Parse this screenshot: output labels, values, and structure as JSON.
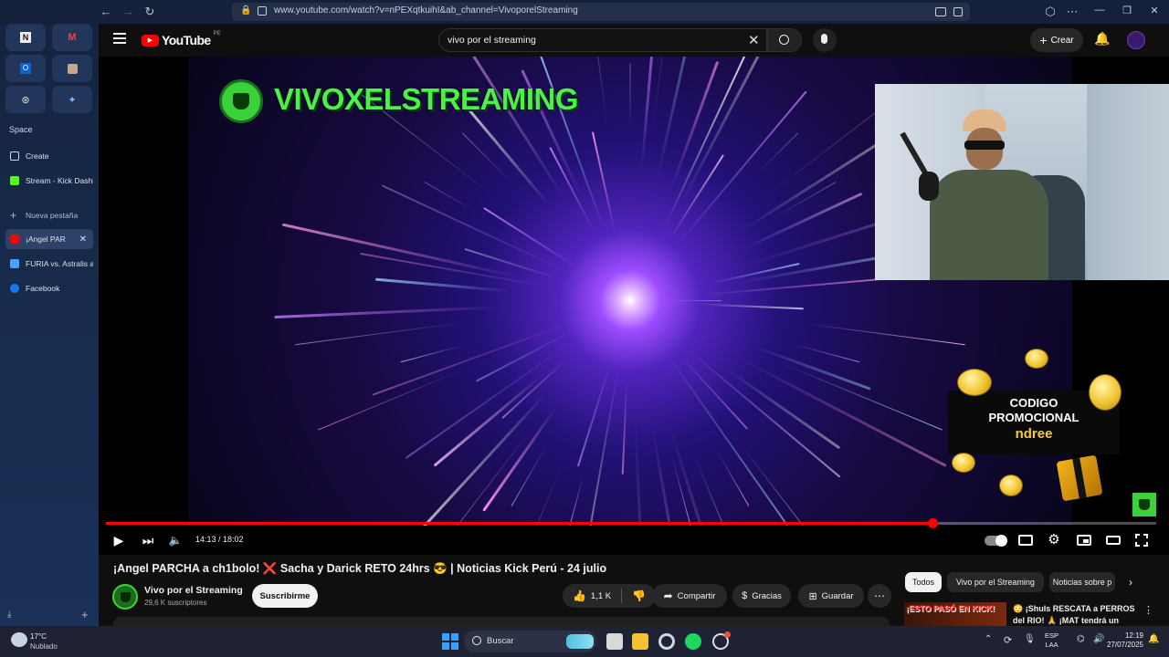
{
  "browser": {
    "url": "www.youtube.com/watch?v=nPEXqtkuihI&ab_channel=VivoporelStreaming"
  },
  "sidebar": {
    "section_label": "Space",
    "items": [
      {
        "label": "Create",
        "color": "#cfd6e4"
      },
      {
        "label": "Stream - Kick Dashb",
        "color": "#53fc18"
      },
      {
        "label": "Nueva pestaña",
        "color": "#cfd6e4"
      },
      {
        "label": "¡Angel PAR",
        "color": "#ff0000"
      },
      {
        "label": "FURIA vs. Astralis at",
        "color": "#4aa3ff"
      },
      {
        "label": "Facebook",
        "color": "#1877f2"
      }
    ]
  },
  "youtube": {
    "logo_text": "YouTube",
    "country_code": "PE",
    "search_value": "vivo por el streaming",
    "create_label": "Crear"
  },
  "video": {
    "overlay_brand": "VIVOXELSTREAMING",
    "promo_line1": "CODIGO",
    "promo_line2": "PROMOCIONAL",
    "promo_code": "ndree",
    "time_display": "14:13 / 18:02",
    "progress": 0.787
  },
  "meta": {
    "title": "¡Angel PARCHA a ch1bolo! ❌ Sacha y Darick RETO 24hrs 😎 | Noticias Kick Perú - 24 julio",
    "channel_name": "Vivo por el Streaming",
    "subscribers": "29,6 K suscriptores",
    "subscribe_label": "Suscribirme",
    "likes": "1,1 K",
    "share_label": "Compartir",
    "thanks_label": "Gracias",
    "save_label": "Guardar"
  },
  "chips": [
    "Todos",
    "Vivo por el Streaming",
    "Noticias sobre p"
  ],
  "recommendation": {
    "thumb_text": "¡ESTO PASÓ EN KICK!",
    "title_line1": "😳 ¡Shuls RESCATA a PERROS",
    "title_line2": "del RIO! 🙏 ¡MAT tendrá un"
  },
  "taskbar": {
    "weather_temp": "17°C",
    "weather_desc": "Nublado",
    "search_label": "Buscar",
    "lang_line1": "ESP",
    "lang_line2": "LAA",
    "time": "12:19",
    "date": "27/07/2025"
  }
}
